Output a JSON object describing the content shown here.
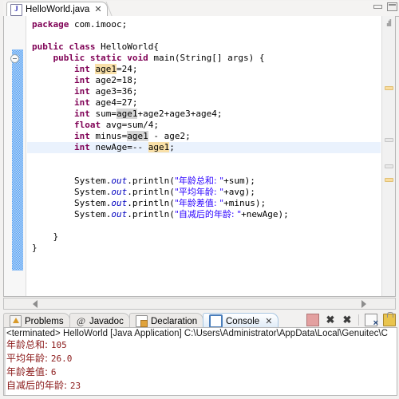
{
  "editor": {
    "tab": {
      "label": "HelloWorld.java",
      "icon": "java-file-icon",
      "icon_glyph": "J",
      "close_glyph": "✕"
    },
    "window_buttons": {
      "minimize": "minimize-button",
      "maximize": "maximize-button"
    },
    "code_lines": [
      {
        "indent": 0,
        "segments": [
          {
            "t": "package",
            "c": "kw"
          },
          {
            "t": " com.imooc;",
            "c": ""
          }
        ]
      },
      {
        "indent": 0,
        "segments": [
          {
            "t": "",
            "c": ""
          }
        ]
      },
      {
        "indent": 0,
        "segments": [
          {
            "t": "public",
            "c": "kw"
          },
          {
            "t": " ",
            "c": ""
          },
          {
            "t": "class",
            "c": "kw"
          },
          {
            "t": " HelloWorld{",
            "c": ""
          }
        ]
      },
      {
        "indent": 1,
        "segments": [
          {
            "t": "public",
            "c": "kw"
          },
          {
            "t": " ",
            "c": ""
          },
          {
            "t": "static",
            "c": "kw"
          },
          {
            "t": " ",
            "c": ""
          },
          {
            "t": "void",
            "c": "kw"
          },
          {
            "t": " main(String[] args) {",
            "c": ""
          }
        ]
      },
      {
        "indent": 2,
        "segments": [
          {
            "t": "int",
            "c": "kw"
          },
          {
            "t": " ",
            "c": ""
          },
          {
            "t": "age1",
            "c": "hl-occ"
          },
          {
            "t": "=24;",
            "c": ""
          }
        ]
      },
      {
        "indent": 2,
        "segments": [
          {
            "t": "int",
            "c": "kw"
          },
          {
            "t": " age2=18;",
            "c": ""
          }
        ]
      },
      {
        "indent": 2,
        "segments": [
          {
            "t": "int",
            "c": "kw"
          },
          {
            "t": " age3=36;",
            "c": ""
          }
        ]
      },
      {
        "indent": 2,
        "segments": [
          {
            "t": "int",
            "c": "kw"
          },
          {
            "t": " age4=27;",
            "c": ""
          }
        ]
      },
      {
        "indent": 2,
        "segments": [
          {
            "t": "int",
            "c": "kw"
          },
          {
            "t": " sum=",
            "c": ""
          },
          {
            "t": "age1",
            "c": "hl-write"
          },
          {
            "t": "+age2+age3+age4;",
            "c": ""
          }
        ]
      },
      {
        "indent": 2,
        "segments": [
          {
            "t": "float",
            "c": "kw"
          },
          {
            "t": " avg=sum/4;",
            "c": ""
          }
        ]
      },
      {
        "indent": 2,
        "segments": [
          {
            "t": "int",
            "c": "kw"
          },
          {
            "t": " minus=",
            "c": ""
          },
          {
            "t": "age1",
            "c": "hl-write"
          },
          {
            "t": " - age2;",
            "c": ""
          }
        ]
      },
      {
        "indent": 2,
        "current": true,
        "segments": [
          {
            "t": "int",
            "c": "kw"
          },
          {
            "t": " newAge=-- ",
            "c": ""
          },
          {
            "t": "age1",
            "c": "hl-occ"
          },
          {
            "t": ";",
            "c": ""
          }
        ]
      },
      {
        "indent": 0,
        "segments": [
          {
            "t": "",
            "c": ""
          }
        ]
      },
      {
        "indent": 0,
        "segments": [
          {
            "t": "",
            "c": ""
          }
        ]
      },
      {
        "indent": 2,
        "segments": [
          {
            "t": "System.",
            "c": ""
          },
          {
            "t": "out",
            "c": "fld"
          },
          {
            "t": ".println(",
            "c": ""
          },
          {
            "t": "\"年龄总和: \"",
            "c": "str cjk"
          },
          {
            "t": "+sum);",
            "c": ""
          }
        ]
      },
      {
        "indent": 2,
        "segments": [
          {
            "t": "System.",
            "c": ""
          },
          {
            "t": "out",
            "c": "fld"
          },
          {
            "t": ".println(",
            "c": ""
          },
          {
            "t": "\"平均年龄: \"",
            "c": "str cjk"
          },
          {
            "t": "+avg);",
            "c": ""
          }
        ]
      },
      {
        "indent": 2,
        "segments": [
          {
            "t": "System.",
            "c": ""
          },
          {
            "t": "out",
            "c": "fld"
          },
          {
            "t": ".println(",
            "c": ""
          },
          {
            "t": "\"年龄差值: \"",
            "c": "str cjk"
          },
          {
            "t": "+minus);",
            "c": ""
          }
        ]
      },
      {
        "indent": 2,
        "segments": [
          {
            "t": "System.",
            "c": ""
          },
          {
            "t": "out",
            "c": "fld"
          },
          {
            "t": ".println(",
            "c": ""
          },
          {
            "t": "\"自减后的年龄: \"",
            "c": "str cjk"
          },
          {
            "t": "+newAge);",
            "c": ""
          }
        ]
      },
      {
        "indent": 0,
        "segments": [
          {
            "t": "",
            "c": ""
          }
        ]
      },
      {
        "indent": 1,
        "segments": [
          {
            "t": "}",
            "c": ""
          }
        ]
      },
      {
        "indent": 0,
        "segments": [
          {
            "t": "}",
            "c": ""
          }
        ]
      }
    ],
    "scrollbar": {
      "left_arrow": "scroll-left-arrow",
      "right_arrow": "scroll-right-arrow"
    }
  },
  "console_panel": {
    "tabs": [
      {
        "label": "Problems",
        "icon": "problems-icon",
        "active": false
      },
      {
        "label": "Javadoc",
        "icon": "javadoc-icon",
        "active": false
      },
      {
        "label": "Declaration",
        "icon": "declaration-icon",
        "active": false
      },
      {
        "label": "Console",
        "icon": "console-icon",
        "active": true,
        "close_glyph": "✕"
      }
    ],
    "toolbar": [
      {
        "name": "terminate-button",
        "title": "Terminate"
      },
      {
        "name": "remove-launch-button",
        "title": "Remove Launch",
        "glyph": "✖"
      },
      {
        "name": "remove-all-terminated-button",
        "title": "Remove All Terminated Launches",
        "glyph": "✖"
      },
      {
        "name": "clear-console-button",
        "title": "Clear Console"
      },
      {
        "name": "scroll-lock-button",
        "title": "Scroll Lock"
      }
    ],
    "header": "<terminated> HelloWorld [Java Application] C:\\Users\\Administrator\\AppData\\Local\\Genuitec\\C",
    "output_lines": [
      {
        "label": "年龄总和: ",
        "value": "105"
      },
      {
        "label": "平均年龄: ",
        "value": "26.0"
      },
      {
        "label": "年龄差值: ",
        "value": "6"
      },
      {
        "label": "自减后的年龄: ",
        "value": "23"
      }
    ]
  },
  "colors": {
    "keyword": "#7f0055",
    "string": "#2a00ff",
    "field": "#0000c0",
    "occurrence_read": "#f9e0a8",
    "occurrence_write": "#d6d6d6",
    "current_line": "#eaf2fd",
    "console_stdout": "#8b1a1a"
  }
}
